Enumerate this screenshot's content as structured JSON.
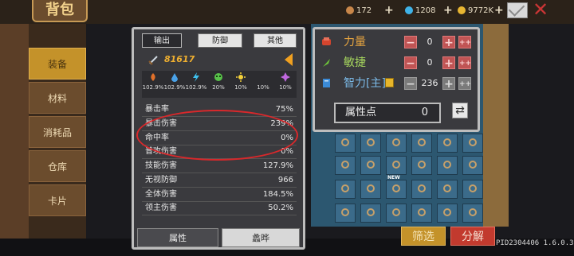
{
  "header": {
    "title": "背包",
    "resources": [
      {
        "name": "wood-icon",
        "value": "172",
        "color": "#c8874a"
      },
      {
        "name": "gem-icon",
        "value": "1208",
        "color": "#3fb3e8"
      },
      {
        "name": "coin-icon",
        "value": "9772K",
        "color": "#e8b632"
      }
    ]
  },
  "sidebar": {
    "items": [
      {
        "label": "装备",
        "active": true
      },
      {
        "label": "材料",
        "active": false
      },
      {
        "label": "消耗品",
        "active": false
      },
      {
        "label": "仓库",
        "active": false
      },
      {
        "label": "卡片",
        "active": false
      }
    ]
  },
  "stats_panel": {
    "tabs": [
      "输出",
      "防御",
      "其他"
    ],
    "active_tab": "输出",
    "durability": "81617",
    "elements": [
      {
        "icon": "fire-icon",
        "value": "102.9%",
        "color": "#e0702a"
      },
      {
        "icon": "water-icon",
        "value": "102.9%",
        "color": "#4aa2e8"
      },
      {
        "icon": "lightning-icon",
        "value": "102.9%",
        "color": "#3ec2f0"
      },
      {
        "icon": "poison-icon",
        "value": "20%",
        "color": "#58c24a"
      },
      {
        "icon": "light-icon",
        "value": "10%",
        "color": "#f5d23a"
      },
      {
        "icon": "dark-icon",
        "value": "10%",
        "color": "#a8253e"
      },
      {
        "icon": "arcane-icon",
        "value": "10%",
        "color": "#c068e0"
      }
    ],
    "stats": [
      {
        "label": "暴击率",
        "value": "75%"
      },
      {
        "label": "暴击伤害",
        "value": "239%"
      },
      {
        "label": "命中率",
        "value": "0%"
      },
      {
        "label": "普攻伤害",
        "value": "0%"
      },
      {
        "label": "技能伤害",
        "value": "127.9%"
      },
      {
        "label": "无视防御",
        "value": "966"
      },
      {
        "label": "全体伤害",
        "value": "184.5%"
      },
      {
        "label": "领主伤害",
        "value": "50.2%"
      }
    ],
    "bottom_tabs": [
      "属性",
      "蠡晔"
    ]
  },
  "attr_panel": {
    "attributes": [
      {
        "name": "力量",
        "value": "0",
        "color": "#e8a640"
      },
      {
        "name": "敏捷",
        "value": "0",
        "color": "#a6d65e"
      },
      {
        "name": "智力[主]",
        "value": "236",
        "color": "#7ab8e6"
      }
    ],
    "points_label": "属性点",
    "points_value": "0"
  },
  "actions": {
    "filter_label": "筛选",
    "decompose_label": "分解"
  },
  "footer": {
    "build": "PID2304406 1.6.0.3"
  },
  "grid": {
    "new_badge": "NEW"
  }
}
